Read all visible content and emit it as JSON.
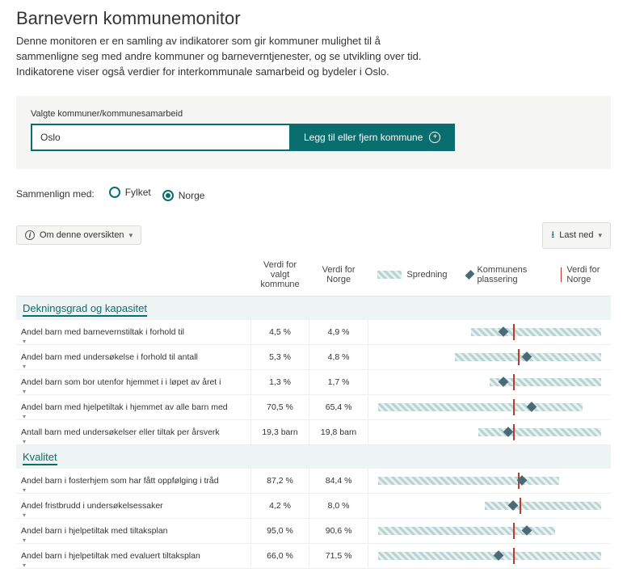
{
  "header": {
    "title": "Barnevern kommunemonitor",
    "intro": "Denne monitoren er en samling av indikatorer som gir kommuner mulighet til å sammenligne seg med andre kommuner og barneverntjenester, og se utvikling over tid. Indikatorene viser også verdier for interkommunale samarbeid og bydeler i Oslo."
  },
  "selector": {
    "label": "Valgte kommuner/kommunesamarbeid",
    "value": "Oslo",
    "button": "Legg til eller fjern kommune"
  },
  "compare": {
    "label": "Sammenlign med:",
    "options": [
      {
        "label": "Fylket",
        "checked": false
      },
      {
        "label": "Norge",
        "checked": true
      }
    ]
  },
  "toolbar": {
    "about": "Om denne oversikten",
    "download": "Last ned"
  },
  "table": {
    "columns": {
      "valgt": "Verdi for valgt kommune",
      "norge": "Verdi for Norge"
    },
    "legend": {
      "spread": "Spredning",
      "placement": "Kommunens plassering",
      "norm": "Verdi for Norge"
    },
    "sections": [
      {
        "title": "Dekningsgrad og kapasitet",
        "rows": [
          {
            "label": "Andel barn med barnevernstiltak i forhold til",
            "valgt": "4,5 %",
            "norge": "4,9 %",
            "plot": {
              "rs": 42,
              "re": 98,
              "norm": 60,
              "mark": 56
            }
          },
          {
            "label": "Andel barn med undersøkelse i forhold til antall",
            "valgt": "5,3 %",
            "norge": "4,8 %",
            "plot": {
              "rs": 35,
              "re": 98,
              "norm": 62,
              "mark": 66
            }
          },
          {
            "label": "Andel barn som bor utenfor hjemmet i i løpet av året i",
            "valgt": "1,3 %",
            "norge": "1,7 %",
            "plot": {
              "rs": 50,
              "re": 98,
              "norm": 60,
              "mark": 56
            }
          },
          {
            "label": "Andel barn med hjelpetiltak i hjemmet av alle barn med",
            "valgt": "70,5 %",
            "norge": "65,4 %",
            "plot": {
              "rs": 2,
              "re": 90,
              "norm": 60,
              "mark": 68
            }
          },
          {
            "label": "Antall barn med undersøkelser eller tiltak per årsverk",
            "valgt": "19,3 barn",
            "norge": "19,8 barn",
            "plot": {
              "rs": 45,
              "re": 98,
              "norm": 60,
              "mark": 58
            }
          }
        ]
      },
      {
        "title": "Kvalitet",
        "rows": [
          {
            "label": "Andel barn i fosterhjem som har fått oppfølging i tråd",
            "valgt": "87,2 %",
            "norge": "84,4 %",
            "plot": {
              "rs": 2,
              "re": 80,
              "norm": 62,
              "mark": 64
            }
          },
          {
            "label": "Andel fristbrudd i undersøkelsessaker",
            "valgt": "4,2 %",
            "norge": "8,0 %",
            "plot": {
              "rs": 48,
              "re": 98,
              "norm": 63,
              "mark": 60
            }
          },
          {
            "label": "Andel barn i hjelpetiltak med tiltaksplan",
            "valgt": "95,0 %",
            "norge": "90,6 %",
            "plot": {
              "rs": 2,
              "re": 78,
              "norm": 60,
              "mark": 66
            }
          },
          {
            "label": "Andel barn i hjelpetiltak med evaluert tiltaksplan",
            "valgt": "66,0 %",
            "norge": "71,5 %",
            "plot": {
              "rs": 2,
              "re": 98,
              "norm": 60,
              "mark": 54
            }
          }
        ]
      }
    ]
  }
}
